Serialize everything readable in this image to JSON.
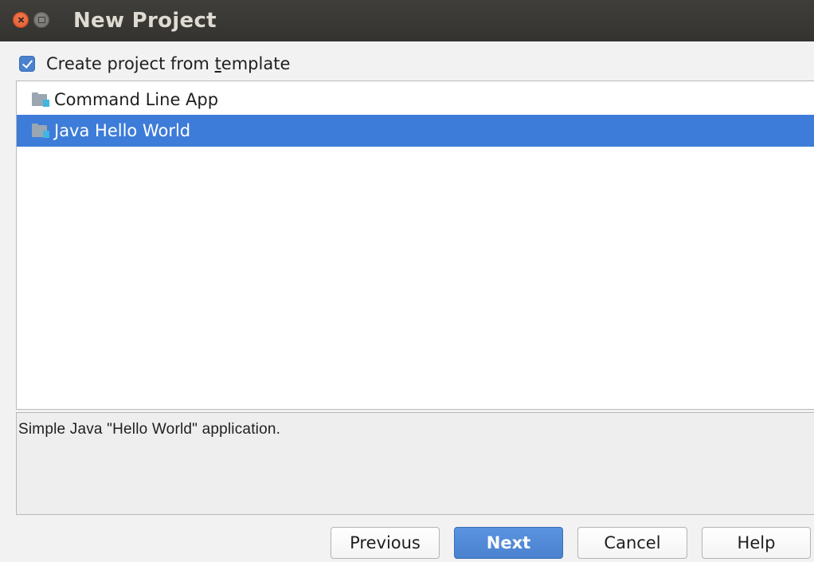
{
  "window": {
    "title": "New Project"
  },
  "template_option": {
    "label_before": "Create project from ",
    "label_underlined": "t",
    "label_after": "emplate",
    "checked": true
  },
  "templates": {
    "items": [
      {
        "label": "Command Line App",
        "selected": false,
        "icon": "folder-module-icon"
      },
      {
        "label": "Java Hello World",
        "selected": true,
        "icon": "folder-module-icon"
      }
    ]
  },
  "description": {
    "text": "Simple Java \"Hello World\" application."
  },
  "buttons": {
    "previous": "Previous",
    "next": "Next",
    "cancel": "Cancel",
    "help": "Help"
  },
  "colors": {
    "titlebar": "#3c3b37",
    "selection": "#3d7cd8",
    "primary_button": "#4a82cf",
    "close_button": "#e95420"
  }
}
